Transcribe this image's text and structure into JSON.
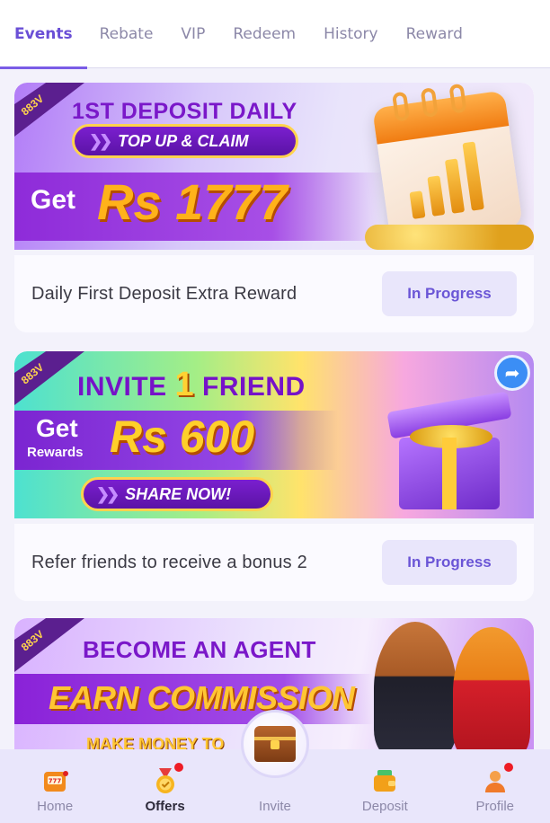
{
  "tabs": [
    {
      "label": "Events",
      "active": true
    },
    {
      "label": "Rebate"
    },
    {
      "label": "VIP"
    },
    {
      "label": "Redeem"
    },
    {
      "label": "History"
    },
    {
      "label": "Reward"
    }
  ],
  "cards": [
    {
      "banner": {
        "brand": "883V",
        "headline": "1ST DEPOSIT DAILY",
        "pill": "TOP UP & CLAIM",
        "get": "Get",
        "amount": "Rs 1777"
      },
      "title": "Daily First Deposit Extra Reward",
      "status": "In Progress"
    },
    {
      "banner": {
        "brand": "883V",
        "headline_pre": "INVITE ",
        "headline_num": "1",
        "headline_post": " FRIEND",
        "get": "Get",
        "rewards": "Rewards",
        "amount": "Rs 600",
        "pill": "SHARE NOW!"
      },
      "title": "Refer friends to receive a bonus 2",
      "status": "In Progress"
    },
    {
      "banner": {
        "brand": "883V",
        "headline": "BECOME AN AGENT",
        "sub": "EARN COMMISSION",
        "tag": "MAKE MONEY TO"
      }
    }
  ],
  "bottom_nav": [
    {
      "label": "Home",
      "icon": "slot-machine-icon"
    },
    {
      "label": "Offers",
      "icon": "medal-icon",
      "active": true,
      "badge": true
    },
    {
      "label": "Invite",
      "icon": "treasure-chest-icon"
    },
    {
      "label": "Deposit",
      "icon": "wallet-icon"
    },
    {
      "label": "Profile",
      "icon": "user-icon",
      "badge": true
    }
  ],
  "colors": {
    "accent": "#6a4fd6",
    "status_bg": "#e9e6fb",
    "badge": "#ee1c25"
  }
}
